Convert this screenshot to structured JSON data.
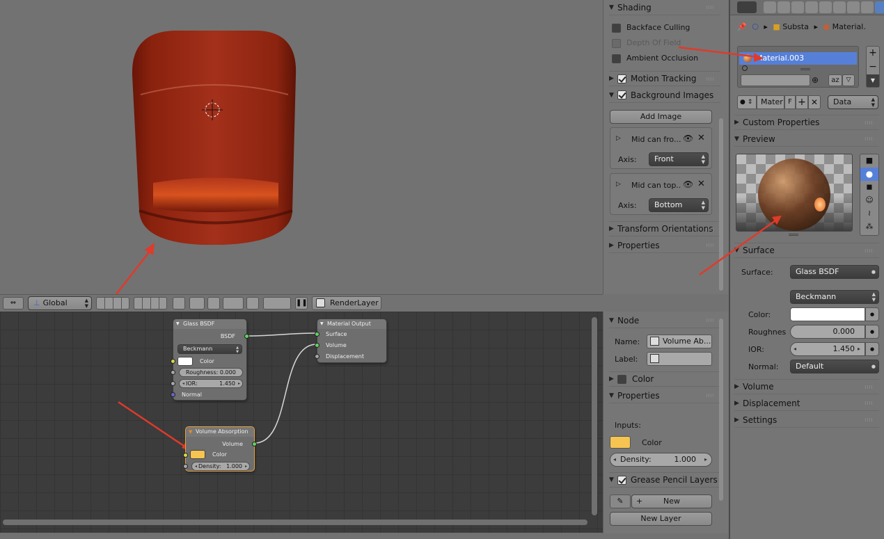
{
  "viewport": {
    "orientation": "Global",
    "render_layer": "RenderLayer"
  },
  "properties_panel": {
    "shading": {
      "title": "Shading",
      "items": [
        {
          "label": "Backface Culling",
          "checked": false,
          "enabled": true
        },
        {
          "label": "Depth Of Field",
          "checked": false,
          "enabled": false
        },
        {
          "label": "Ambient Occlusion",
          "checked": false,
          "enabled": true
        }
      ]
    },
    "motion_tracking": "Motion Tracking",
    "background_images": "Background Images",
    "add_image": "Add Image",
    "bg_images": [
      {
        "name": "Mid can fro...",
        "axis_label": "Axis:",
        "axis": "Front"
      },
      {
        "name": "Mid can top...",
        "axis_label": "Axis:",
        "axis": "Bottom"
      }
    ],
    "transform_orientations": "Transform Orientations",
    "properties": "Properties"
  },
  "node_panel": {
    "node": "Node",
    "name_label": "Name:",
    "name_value": "Volume Ab...",
    "label_label": "Label:",
    "color": "Color",
    "properties": "Properties",
    "inputs": "Inputs:",
    "color_input": "Color",
    "color_hex": "#f5c451",
    "density_label": "Density:",
    "density": "1.000",
    "grease_pencil": "Grease Pencil Layers",
    "new": "New",
    "new_layer": "New Layer"
  },
  "nodes": {
    "glass": {
      "title": "Glass BSDF",
      "out": "BSDF",
      "dist": "Beckmann",
      "color": "Color",
      "roughness": "Roughness: 0.000",
      "ior": "IOR:",
      "ior_val": "1.450",
      "normal": "Normal"
    },
    "output": {
      "title": "Material Output",
      "surface": "Surface",
      "volume": "Volume",
      "displacement": "Displacement"
    },
    "absorption": {
      "title": "Volume Absorption",
      "out": "Volume",
      "color": "Color",
      "density": "Density:",
      "density_val": "1.000"
    }
  },
  "material_panel": {
    "breadcrumb": [
      "Substa",
      "Material."
    ],
    "slot": "Material.003",
    "datablock": "Mater",
    "f_label": "F",
    "link": "Data",
    "custom_properties": "Custom Properties",
    "preview": "Preview",
    "surface_section": "Surface",
    "surface_label": "Surface:",
    "surface_value": "Glass BSDF",
    "distribution": "Beckmann",
    "color_label": "Color:",
    "roughness_label": "Roughnes",
    "roughness": "0.000",
    "ior_label": "IOR:",
    "ior": "1.450",
    "normal_label": "Normal:",
    "normal": "Default",
    "volume": "Volume",
    "displacement": "Displacement",
    "settings": "Settings"
  }
}
